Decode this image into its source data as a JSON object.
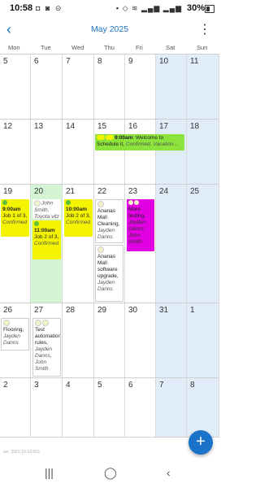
{
  "status_bar": {
    "time": "10:58",
    "battery": "30%"
  },
  "header": {
    "title": "May 2025"
  },
  "weekdays": [
    "Mon",
    "Tue",
    "Wed",
    "Thu",
    "Fri",
    "Sat",
    "Sun"
  ],
  "weeks": [
    [
      "5",
      "6",
      "7",
      "8",
      "9",
      "10",
      "11"
    ],
    [
      "12",
      "13",
      "14",
      "15",
      "16",
      "17",
      "18"
    ],
    [
      "19",
      "20",
      "21",
      "22",
      "23",
      "24",
      "25"
    ],
    [
      "26",
      "27",
      "28",
      "29",
      "30",
      "31",
      "1"
    ],
    [
      "2",
      "3",
      "4",
      "5",
      "6",
      "7",
      "8"
    ]
  ],
  "events": {
    "e1": {
      "time": "9:00am",
      "text": ": Welcome to Schedule it, ",
      "info": "Confirmed, Vacation..."
    },
    "e2": {
      "time": "9:00am",
      "text": "Job 1 of 3, ",
      "info": "Confirmed"
    },
    "e3": {
      "info": "John Smith, Toyota vitz"
    },
    "e4": {
      "time": "11:00am",
      "text": "Job 2 of 3, ",
      "info": "Confirmed"
    },
    "e5": {
      "time": "10:00am",
      "text": "Job 2 of 3, ",
      "info": "Confirmed"
    },
    "e6": {
      "text": "Ananas Mall Cleaning, ",
      "info": "Jayden Danns"
    },
    "e7": {
      "text": "Ananas Mall software upgrade, ",
      "info": "Jayden Danns"
    },
    "e8": {
      "text": "More testing, ",
      "info": "Jayden Danns, John Smith"
    },
    "e9": {
      "text": "Flooring, ",
      "info": "Jayden Danns"
    },
    "e10": {
      "text": "Test automation rules, ",
      "info": "Jayden Danns, John Smith"
    }
  },
  "version": "ver. 2021-10-12.653",
  "colors": {
    "accent": "#1a73c8",
    "weekend": "#e1ecf9",
    "today": "#d3f5d4",
    "yellow": "#f4f400",
    "green": "#8ce33b",
    "magenta": "#e100e1"
  }
}
